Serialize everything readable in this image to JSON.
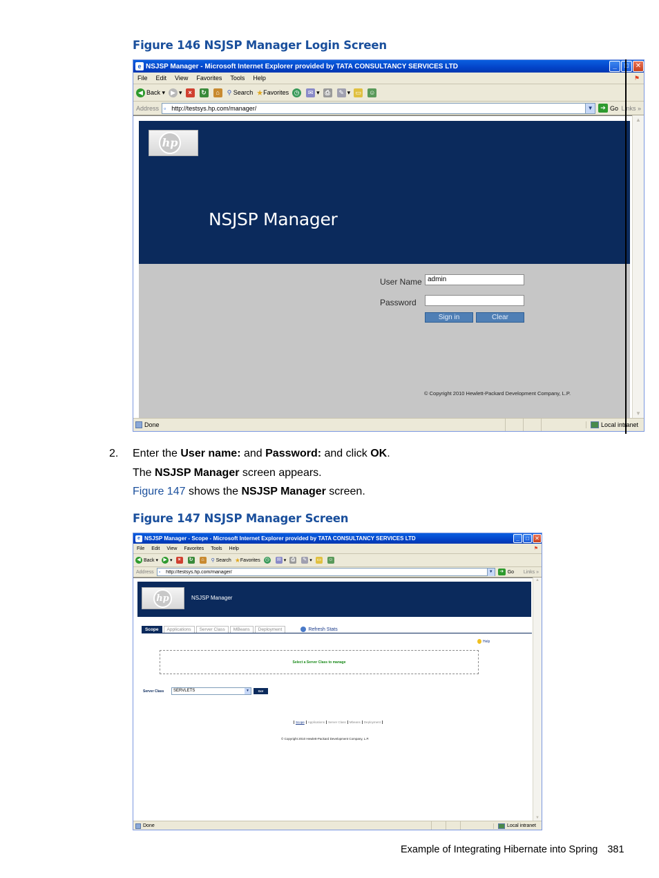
{
  "figures": {
    "fig146": {
      "caption": "Figure 146 NSJSP Manager Login Screen"
    },
    "fig147": {
      "caption": "Figure 147 NSJSP Manager Screen"
    }
  },
  "window1": {
    "title": "NSJSP Manager - Microsoft Internet Explorer provided by TATA CONSULTANCY SERVICES LTD",
    "menu": [
      "File",
      "Edit",
      "View",
      "Favorites",
      "Tools",
      "Help"
    ],
    "toolbar": {
      "back": "Back",
      "search": "Search",
      "favorites": "Favorites"
    },
    "address_label": "Address",
    "url": "http://testsys.hp.com/manager/",
    "go": "Go",
    "links": "Links",
    "app_title": "NSJSP Manager",
    "logo_text": "hp",
    "username_label": "User Name",
    "username_value": "admin",
    "password_label": "Password",
    "password_value": "",
    "signin_label": "Sign in",
    "clear_label": "Clear",
    "copyright": "© Copyright 2010 Hewlett-Packard Development Company, L.P.",
    "status_done": "Done",
    "status_zone": "Local intranet"
  },
  "body": {
    "step_number": "2.",
    "line1": {
      "a": "Enter the ",
      "b": "User name:",
      "c": " and ",
      "d": "Password:",
      "e": " and click ",
      "f": "OK",
      "g": "."
    },
    "line2": {
      "a": "The ",
      "b": "NSJSP Manager",
      "c": " screen appears."
    },
    "line3": {
      "a": "Figure 147",
      "b": " shows the ",
      "c": "NSJSP Manager",
      "d": " screen."
    }
  },
  "window2": {
    "title": "NSJSP Manager - Scope - Microsoft Internet Explorer provided by TATA CONSULTANCY SERVICES LTD",
    "menu": [
      "File",
      "Edit",
      "View",
      "Favorites",
      "Tools",
      "Help"
    ],
    "toolbar": {
      "back": "Back",
      "search": "Search",
      "favorites": "Favorites"
    },
    "address_label": "Address",
    "url": "http://testsys.hp.com/manager/",
    "go": "Go",
    "links": "Links",
    "app_title": "NSJSP Manager",
    "logo_text": "hp",
    "tabs": [
      "Scope",
      "Applications",
      "Server Class",
      "MBeans",
      "Deployment"
    ],
    "refresh": "Refresh Stats",
    "help": "Help",
    "select_msg": "Select a Server Class to manage",
    "server_class_label": "Server Class",
    "server_class_value": "SERVLETS",
    "go_button": "Go!",
    "footer_links": [
      "Scope",
      "Applications",
      "Server Class",
      "Mbeans",
      "Deployment"
    ],
    "copyright": "© Copyright 2010 Hewlett-Packard Development Company, L.P.",
    "status_done": "Done",
    "status_zone": "Local intranet"
  },
  "footer": {
    "text": "Example of Integrating Hibernate into Spring",
    "page": "381"
  },
  "colors": {
    "caption_blue": "#1a4f9c",
    "hp_navy": "#0b2a5c",
    "login_gray": "#c6c6c6",
    "button_blue": "#4f7fb5"
  }
}
